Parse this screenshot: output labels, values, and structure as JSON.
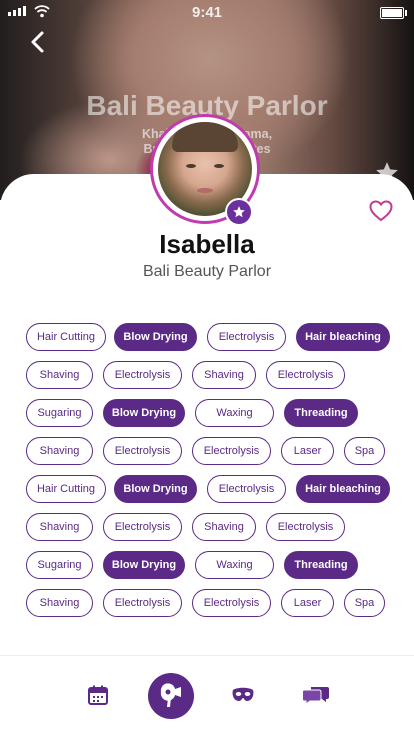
{
  "status_bar": {
    "time": "9:41"
  },
  "hero": {
    "title": "Bali Beauty Parlor",
    "address_line1": "Khalid Bin                Al Karama,",
    "address_line2": "Bur Dubai                 b Emirates"
  },
  "profile": {
    "name": "Isabella",
    "subtitle": "Bali Beauty Parlor"
  },
  "colors": {
    "accent": "#5a2a86",
    "ring": "#c13bb0"
  },
  "icons": {
    "back": "chevron-left-icon",
    "favorite": "heart-outline-icon",
    "badge": "star-icon",
    "tab_calendar": "calendar-icon",
    "tab_dryer": "hair-dryer-icon",
    "tab_mask": "eye-mask-icon",
    "tab_chat": "chat-icon"
  },
  "chips": [
    {
      "label": "Hair Cutting",
      "filled": false
    },
    {
      "label": "Blow Drying",
      "filled": true
    },
    {
      "label": "Electrolysis",
      "filled": false
    },
    {
      "label": "Hair bleaching",
      "filled": true
    },
    {
      "label": "Shaving",
      "filled": false
    },
    {
      "label": "Electrolysis",
      "filled": false
    },
    {
      "label": "Shaving",
      "filled": false
    },
    {
      "label": "Electrolysis",
      "filled": false
    },
    {
      "label": "Sugaring",
      "filled": false
    },
    {
      "label": "Blow Drying",
      "filled": true
    },
    {
      "label": "Waxing",
      "filled": false
    },
    {
      "label": "Threading",
      "filled": true
    },
    {
      "label": "Shaving",
      "filled": false
    },
    {
      "label": "Electrolysis",
      "filled": false
    },
    {
      "label": "Electrolysis",
      "filled": false
    },
    {
      "label": "Laser",
      "filled": false
    },
    {
      "label": "Spa",
      "filled": false
    },
    {
      "label": "Hair Cutting",
      "filled": false
    },
    {
      "label": "Blow Drying",
      "filled": true
    },
    {
      "label": "Electrolysis",
      "filled": false
    },
    {
      "label": "Hair bleaching",
      "filled": true
    },
    {
      "label": "Shaving",
      "filled": false
    },
    {
      "label": "Electrolysis",
      "filled": false
    },
    {
      "label": "Shaving",
      "filled": false
    },
    {
      "label": "Electrolysis",
      "filled": false
    },
    {
      "label": "Sugaring",
      "filled": false
    },
    {
      "label": "Blow Drying",
      "filled": true
    },
    {
      "label": "Waxing",
      "filled": false
    },
    {
      "label": "Threading",
      "filled": true
    },
    {
      "label": "Shaving",
      "filled": false
    },
    {
      "label": "Electrolysis",
      "filled": false
    },
    {
      "label": "Electrolysis",
      "filled": false
    },
    {
      "label": "Laser",
      "filled": false
    },
    {
      "label": "Spa",
      "filled": false
    }
  ]
}
